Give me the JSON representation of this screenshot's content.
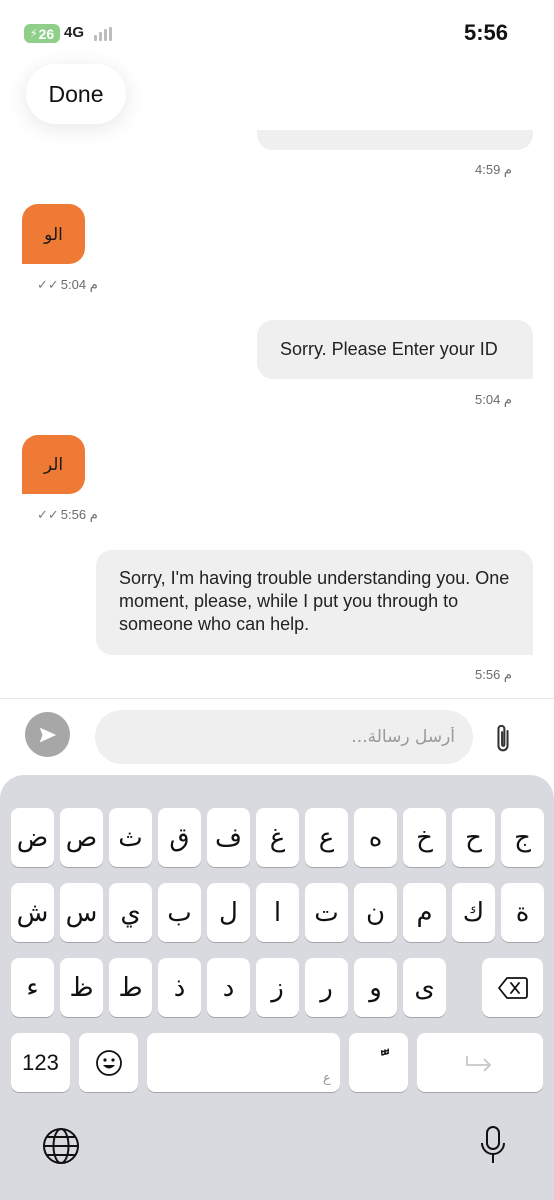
{
  "status_bar": {
    "battery": "26",
    "network": "4G",
    "time": "5:56"
  },
  "header": {
    "done_label": "Done"
  },
  "messages": [
    {
      "from": "bot",
      "text": "",
      "time": "4:59 م"
    },
    {
      "from": "user",
      "text": "الو",
      "time": "5:04 م",
      "read": true
    },
    {
      "from": "bot",
      "text": "Sorry. Please Enter your ID",
      "time": "5:04 م"
    },
    {
      "from": "user",
      "text": "الر",
      "time": "5:56 م",
      "read": true
    },
    {
      "from": "bot",
      "text": "Sorry, I'm having trouble understanding you. One moment, please, while I put you through to someone who can help.",
      "time": "5:56 م"
    }
  ],
  "composer": {
    "placeholder": "أرسل رسالة...",
    "value": ""
  },
  "keyboard": {
    "rows": [
      [
        "ض",
        "ص",
        "ث",
        "ق",
        "ف",
        "غ",
        "ع",
        "ه",
        "خ",
        "ح",
        "ج"
      ],
      [
        "ش",
        "س",
        "ي",
        "ب",
        "ل",
        "ا",
        "ت",
        "ن",
        "م",
        "ك",
        "ة"
      ],
      [
        "ء",
        "ظ",
        "ط",
        "ذ",
        "د",
        "ز",
        "ر",
        "و",
        "ى"
      ]
    ],
    "numbers_label": "123",
    "space_hint": "ع",
    "diacritic_label": "ًّ"
  },
  "colors": {
    "user_bubble": "#ee7a35",
    "bot_bubble": "#efefef",
    "keyboard_bg": "#d9dadf"
  }
}
